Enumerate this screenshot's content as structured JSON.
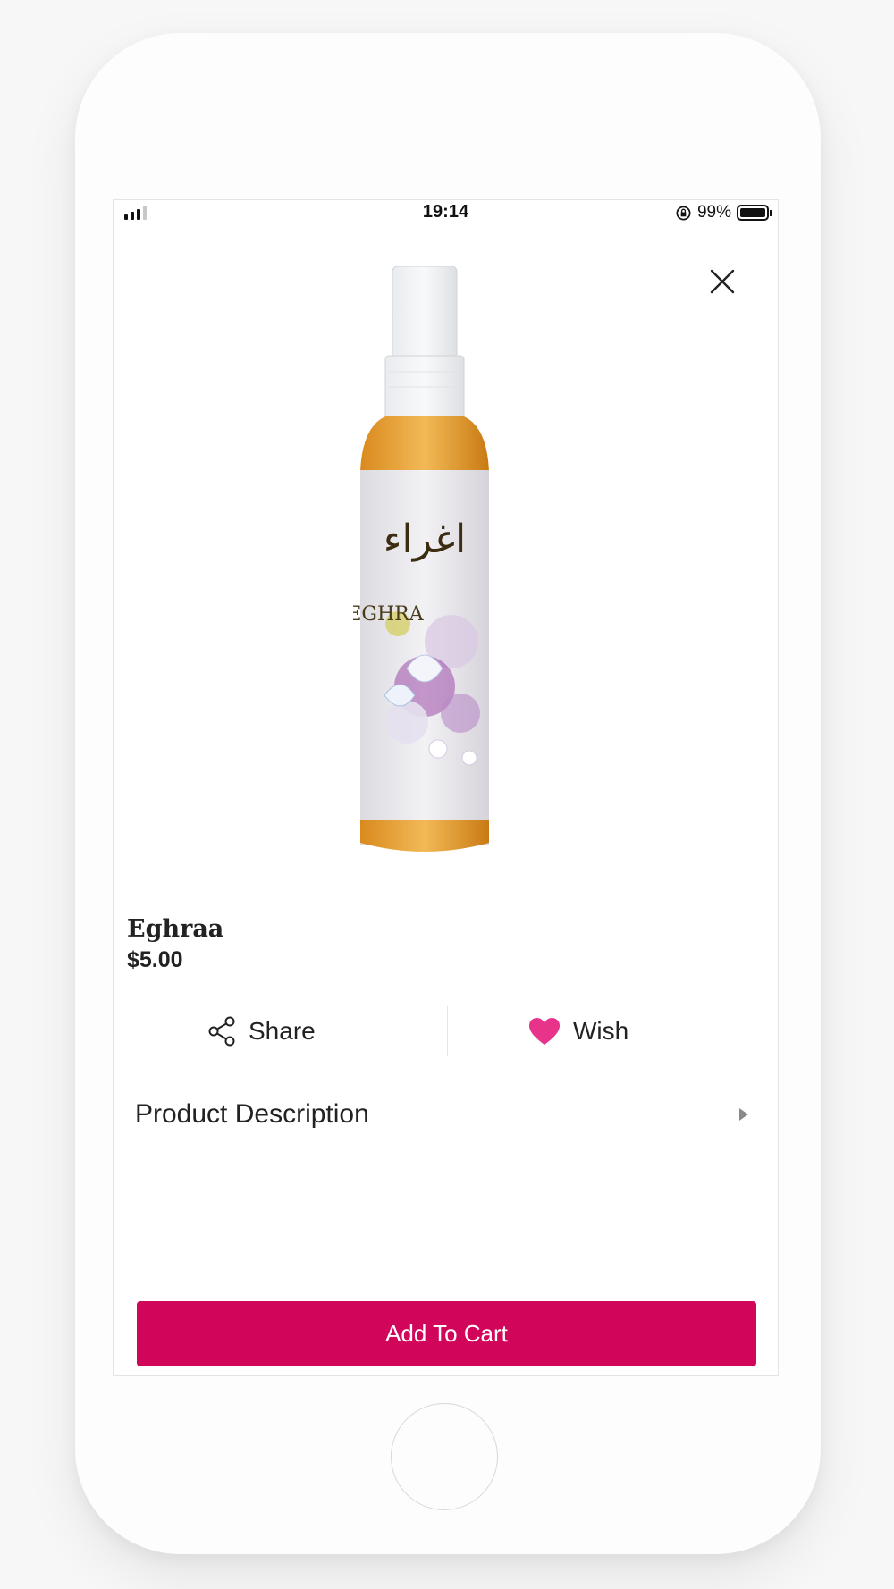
{
  "status_bar": {
    "time": "19:14",
    "battery_percent": "99%"
  },
  "product": {
    "name": "Eghraa",
    "price": "$5.00",
    "image_label_text": "EGHRA"
  },
  "actions": {
    "share_label": "Share",
    "wish_label": "Wish"
  },
  "description": {
    "label": "Product Description"
  },
  "cart": {
    "button_label": "Add To Cart"
  },
  "icons": {
    "close": "close-icon",
    "share": "share-icon",
    "wish": "heart-icon",
    "expand": "chevron-right-icon"
  },
  "colors": {
    "accent": "#d1065a",
    "heart": "#e8338a"
  }
}
